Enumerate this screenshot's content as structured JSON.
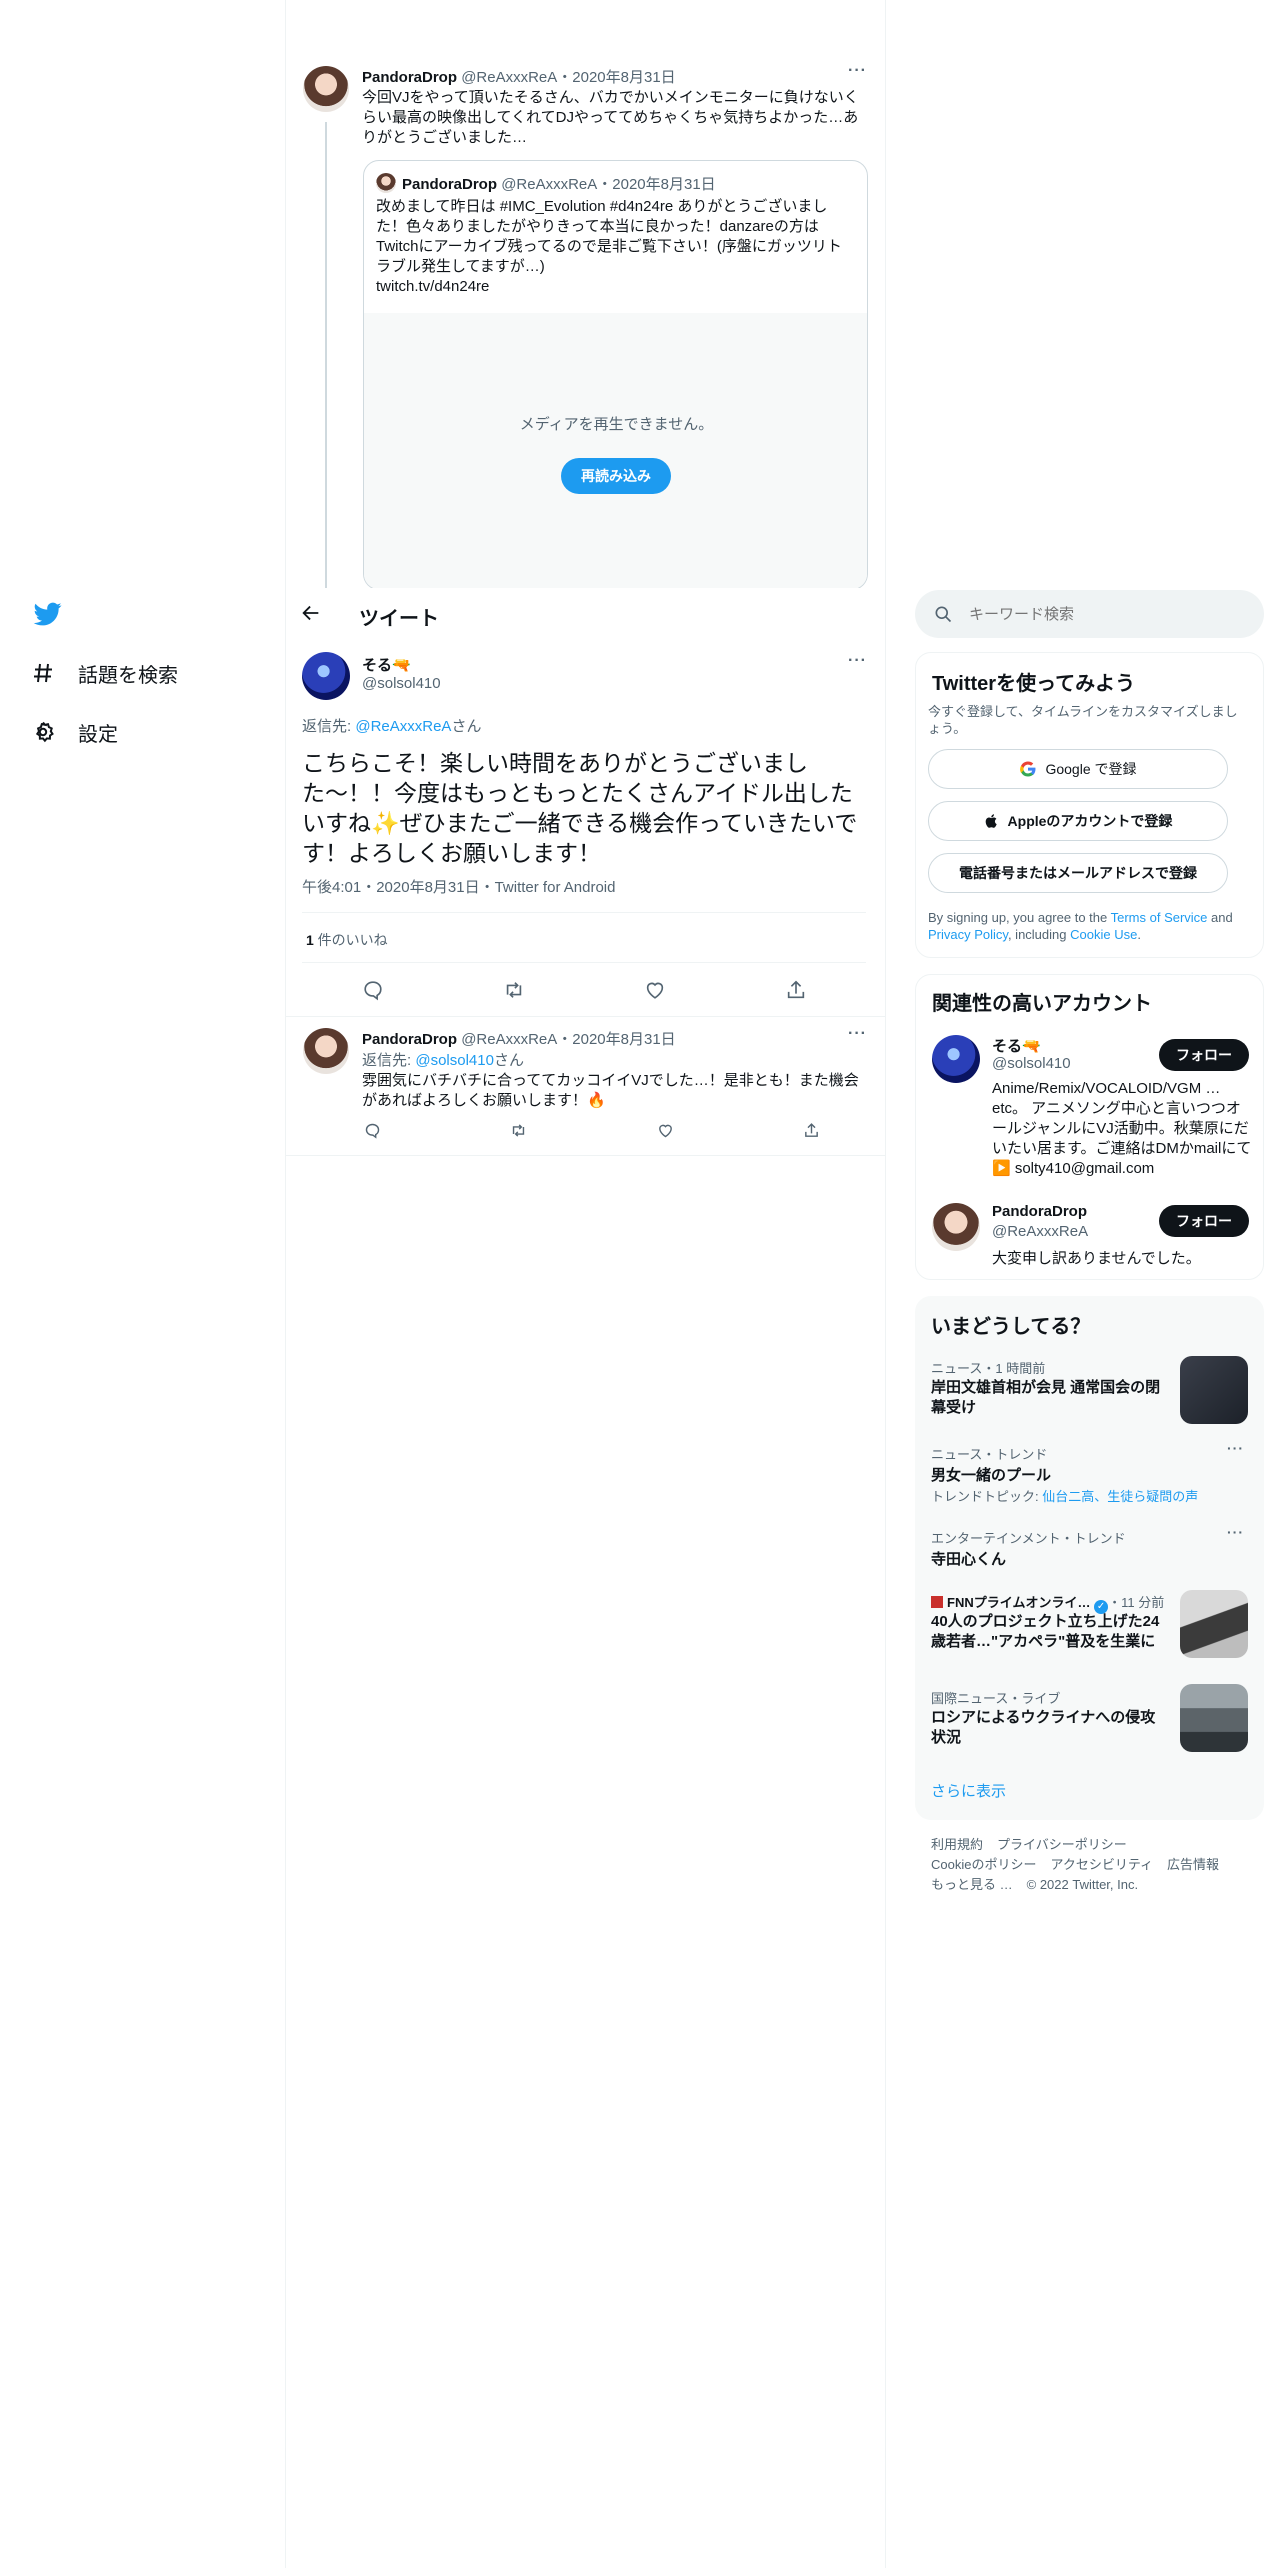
{
  "nav": {
    "items": [
      {
        "label": "話題を検索",
        "icon": "hash-icon"
      },
      {
        "label": "設定",
        "icon": "gear-icon"
      }
    ]
  },
  "header": {
    "title": "ツイート"
  },
  "thread": {
    "parent": {
      "name": "PandoraDrop",
      "handle": "@ReAxxxReA",
      "date": "・2020年8月31日",
      "text": "今回VJをやって頂いたそるさん、バカでかいメインモニターに負けないくらい最高の映像出してくれてDJやっててめちゃくちゃ気持ちよかった…ありがとうございました…",
      "quote": {
        "name": "PandoraDrop",
        "handle": "@ReAxxxReA",
        "date": "・2020年8月31日",
        "text": "改めまして昨日は #IMC_Evolution #d4n24re ありがとうございました！色々ありましたがやりきって本当に良かった！danzareの方はTwitchにアーカイブ残ってるので是非ご覧下さい！(序盤にガッツリトラブル発生してますが…)",
        "link": "twitch.tv/d4n24re",
        "media_error": "メディアを再生できません。",
        "reload_label": "再読み込み"
      }
    },
    "main": {
      "name": "そる",
      "name_emoji": "🔫",
      "handle": "@solsol410",
      "reply_prefix": "返信先: ",
      "reply_to": "@ReAxxxReA",
      "reply_suffix": "さん",
      "text": "こちらこそ！楽しい時間をありがとうございました〜！！今度はもっともっとたくさんアイドル出したいすね✨ぜひまたご一緒できる機会作っていきたいです！よろしくお願いします！",
      "meta": "午後4:01・2020年8月31日・Twitter for Android",
      "likes_count": "1",
      "likes_label": " 件のいいね"
    },
    "reply": {
      "name": "PandoraDrop",
      "handle": "@ReAxxxReA",
      "date": "・2020年8月31日",
      "reply_prefix": "返信先: ",
      "reply_to": "@solsol410",
      "reply_suffix": "さん",
      "text": "雰囲気にバチバチに合っててカッコイイVJでした…！是非とも！また機会があればよろしくお願いします！🔥"
    }
  },
  "search": {
    "placeholder": "キーワード検索"
  },
  "signup": {
    "title": "Twitterを使ってみよう",
    "subtitle": "今すぐ登録して、タイムラインをカスタマイズしましょう。",
    "google_label": "Google で登録",
    "apple_label": "Appleのアカウントで登録",
    "phone_label": "電話番号またはメールアドレスで登録",
    "terms_prefix": "By signing up, you agree to the ",
    "terms_link": "Terms of Service",
    "terms_mid": " and ",
    "privacy_link": "Privacy Policy",
    "terms_mid2": ", including ",
    "cookie_link": "Cookie Use",
    "terms_end": "."
  },
  "relevant": {
    "title": "関連性の高いアカウント",
    "follow_label": "フォロー",
    "accounts": [
      {
        "name": "そる🔫",
        "handle": "@solsol410",
        "bio": "Anime/Remix/VOCALOID/VGM … etc。 アニメソング中心と言いつつオールジャンルにVJ活動中。秋葉原にだいたい居ます。ご連絡はDMかmailにて▶️ solty410@gmail.com"
      },
      {
        "name": "PandoraDrop",
        "handle": "@ReAxxxReA",
        "bio": "大変申し訳ありませんでした。"
      }
    ]
  },
  "trends": {
    "title": "いまどうしてる？",
    "items": [
      {
        "meta": "ニュース・1 時間前",
        "title": "岸田文雄首相が会見 通常国会の閉幕受け"
      },
      {
        "meta": "ニュース・トレンド",
        "title": "男女一緒のプール",
        "topic_prefix": "トレンドトピック: ",
        "topic": "仙台二高、生徒ら疑問の声"
      },
      {
        "meta": "エンターテインメント・トレンド",
        "title": "寺田心くん"
      },
      {
        "source": "FNNプライムオンライ…",
        "time": "・11 分前",
        "title": "40人のプロジェクト立ち上げた24歳若者…\"アカペラ\"普及を生業に"
      },
      {
        "meta": "国際ニュース・ライブ",
        "title": "ロシアによるウクライナへの侵攻状況"
      }
    ],
    "show_more": "さらに表示"
  },
  "footer": {
    "line1": [
      "利用規約",
      "プライバシーポリシー"
    ],
    "line2": [
      "Cookieのポリシー",
      "アクセシビリティ",
      "広告情報"
    ],
    "more": "もっと見る …",
    "copyright": "© 2022 Twitter, Inc."
  },
  "colors": {
    "accent": "#1d9bf0",
    "text": "#0f1419",
    "muted": "#536471",
    "border": "#eff3f4"
  }
}
